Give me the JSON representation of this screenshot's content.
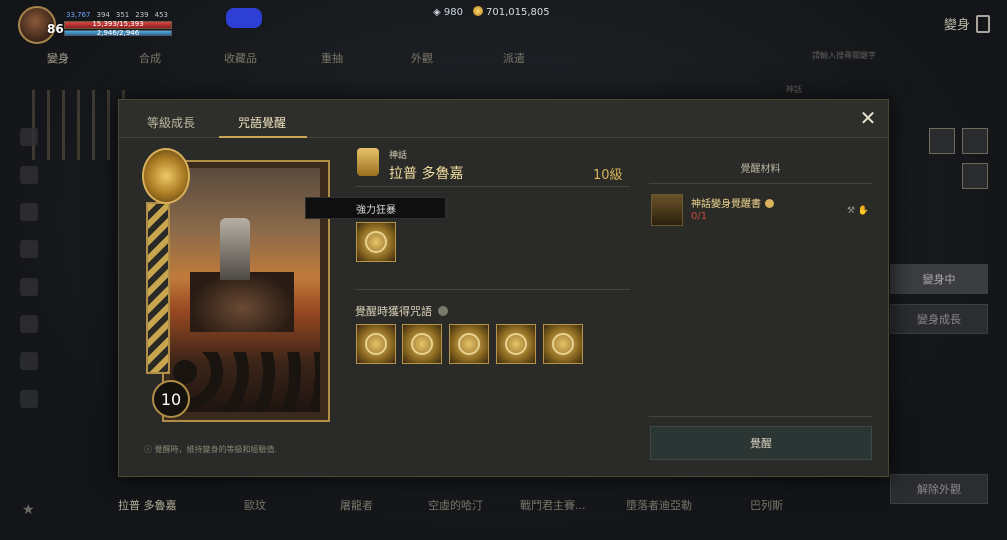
{
  "hud": {
    "level": "86",
    "stat_blue": "33,767",
    "stat2": "394",
    "stat3": "351",
    "stat4": "239",
    "stat5": "453",
    "hp": "15,393/15,393",
    "mp": "2,946/2,946",
    "diamonds": "980",
    "gold": "701,015,805",
    "corner_title": "變身"
  },
  "bg_tabs": [
    "變身",
    "合成",
    "收藏品",
    "重抽",
    "外觀",
    "派遣"
  ],
  "search_placeholder": "請輸入搜尋關鍵字",
  "bg_grade_label": "神話",
  "right_buttons": [
    "變身中",
    "變身成長",
    "解除外觀"
  ],
  "bottom_list": [
    "拉普 多魯嘉",
    "歐玟",
    "屠龍者",
    "空虛的哈汀",
    "戰鬥君主賽...",
    "墮落者迪亞勒",
    "巴列斯"
  ],
  "modal": {
    "tabs": [
      "等級成長",
      "咒語覺醒"
    ],
    "active_tab": 1,
    "grade": "神話",
    "name": "拉普 多魯嘉",
    "level_text": "10級",
    "card_level": "10",
    "tooltip": "強力狂暴",
    "awaken_spells_title": "覺醒時獲得咒語",
    "materials_title": "覺醒材料",
    "material": {
      "name": "神話變身覺醒書",
      "count": "0/1"
    },
    "awaken_button": "覺醒",
    "footnote": "覺醒時，維持變身的等級和經驗值."
  }
}
